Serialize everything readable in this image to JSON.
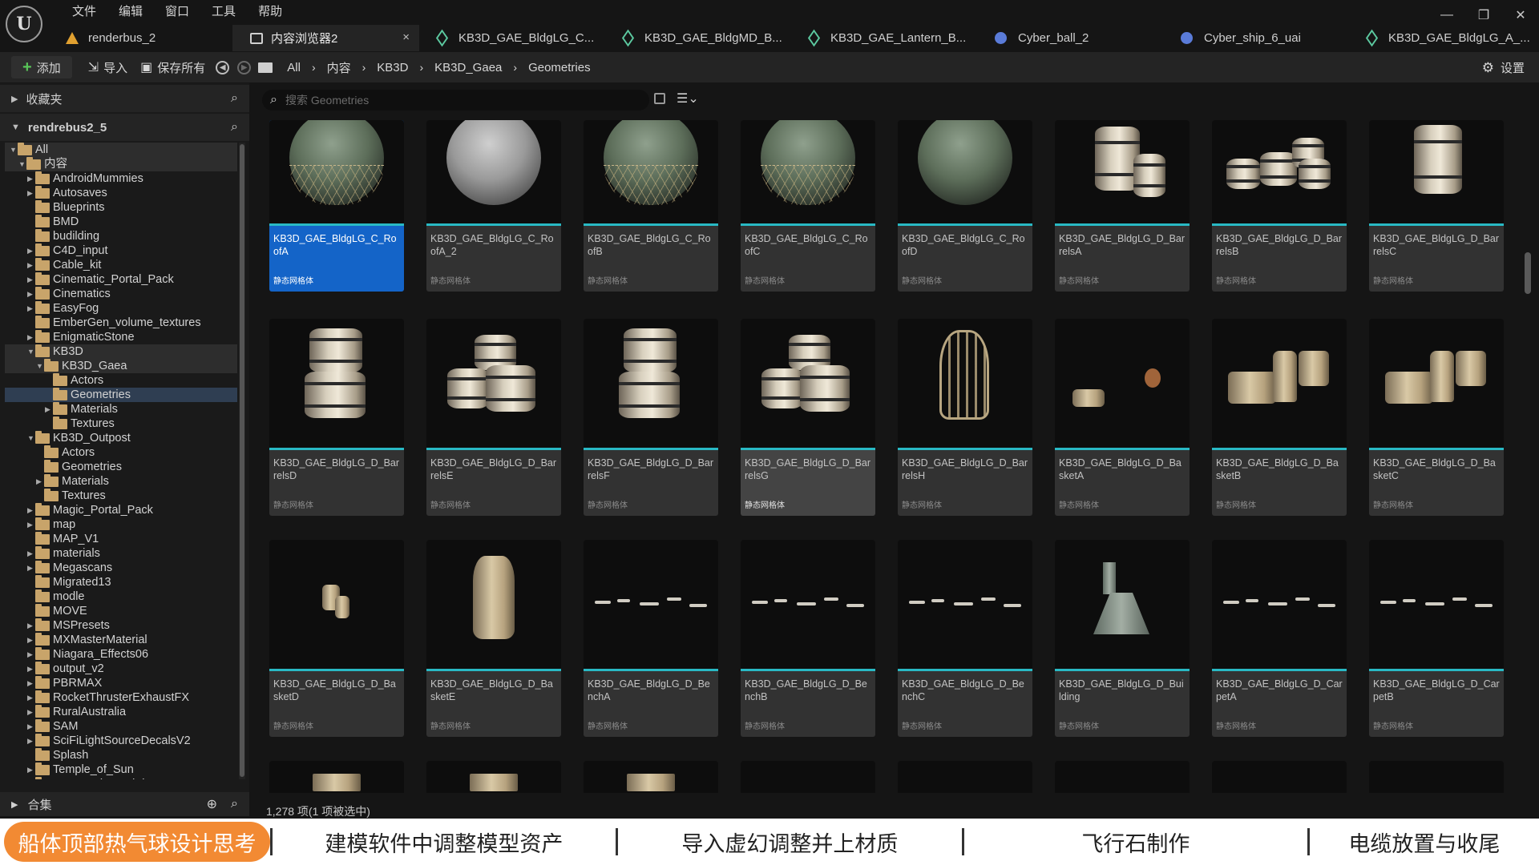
{
  "app": {
    "logo": "U",
    "menu": [
      "文件",
      "编辑",
      "窗口",
      "工具",
      "帮助"
    ],
    "window_controls": [
      "—",
      "❐",
      "✕"
    ]
  },
  "tabs": [
    {
      "label": "renderbus_2",
      "icon": "level-icon",
      "icon_color": "#e0a030",
      "active": false
    },
    {
      "label": "内容浏览器2",
      "icon": "content-browser-icon",
      "icon_color": "#d0d0d0",
      "active": true,
      "close": "×"
    },
    {
      "label": "KB3D_GAE_BldgLG_C...",
      "icon": "static-mesh-icon",
      "icon_color": "#5cc9a0",
      "active": false
    },
    {
      "label": "KB3D_GAE_BldgMD_B...",
      "icon": "static-mesh-icon",
      "icon_color": "#5cc9a0",
      "active": false
    },
    {
      "label": "KB3D_GAE_Lantern_B...",
      "icon": "static-mesh-icon",
      "icon_color": "#5cc9a0",
      "active": false
    },
    {
      "label": "Cyber_ball_2",
      "icon": "blueprint-icon",
      "icon_color": "#5a7bd8",
      "active": false
    },
    {
      "label": "Cyber_ship_6_uai",
      "icon": "blueprint-icon",
      "icon_color": "#5a7bd8",
      "active": false
    },
    {
      "label": "KB3D_GAE_BldgLG_A_...",
      "icon": "static-mesh-icon",
      "icon_color": "#5cc9a0",
      "active": false
    }
  ],
  "toolbar": {
    "add": "添加",
    "import": "导入",
    "save_all": "保存所有",
    "breadcrumb": [
      "All",
      "内容",
      "KB3D",
      "KB3D_Gaea",
      "Geometries"
    ],
    "settings": "设置"
  },
  "left": {
    "favorites": "收藏夹",
    "project": "rendrebus2_5",
    "collections": "合集",
    "tree": [
      {
        "label": "All",
        "depth": 0,
        "exp": "▼",
        "state": "hl"
      },
      {
        "label": "内容",
        "depth": 1,
        "exp": "▼",
        "state": "hl"
      },
      {
        "label": "AndroidMummies",
        "depth": 2,
        "exp": "▶"
      },
      {
        "label": "Autosaves",
        "depth": 2,
        "exp": "▶"
      },
      {
        "label": "Blueprints",
        "depth": 2,
        "exp": ""
      },
      {
        "label": "BMD",
        "depth": 2,
        "exp": ""
      },
      {
        "label": "budilding",
        "depth": 2,
        "exp": ""
      },
      {
        "label": "C4D_input",
        "depth": 2,
        "exp": "▶"
      },
      {
        "label": "Cable_kit",
        "depth": 2,
        "exp": "▶"
      },
      {
        "label": "Cinematic_Portal_Pack",
        "depth": 2,
        "exp": "▶"
      },
      {
        "label": "Cinematics",
        "depth": 2,
        "exp": "▶"
      },
      {
        "label": "EasyFog",
        "depth": 2,
        "exp": "▶"
      },
      {
        "label": "EmberGen_volume_textures",
        "depth": 2,
        "exp": ""
      },
      {
        "label": "EnigmaticStone",
        "depth": 2,
        "exp": "▶"
      },
      {
        "label": "KB3D",
        "depth": 2,
        "exp": "▼",
        "state": "hl"
      },
      {
        "label": "KB3D_Gaea",
        "depth": 3,
        "exp": "▼",
        "state": "hl"
      },
      {
        "label": "Actors",
        "depth": 4,
        "exp": ""
      },
      {
        "label": "Geometries",
        "depth": 4,
        "exp": "",
        "state": "sel"
      },
      {
        "label": "Materials",
        "depth": 4,
        "exp": "▶"
      },
      {
        "label": "Textures",
        "depth": 4,
        "exp": ""
      },
      {
        "label": "KB3D_Outpost",
        "depth": 2,
        "exp": "▼"
      },
      {
        "label": "Actors",
        "depth": 3,
        "exp": ""
      },
      {
        "label": "Geometries",
        "depth": 3,
        "exp": ""
      },
      {
        "label": "Materials",
        "depth": 3,
        "exp": "▶"
      },
      {
        "label": "Textures",
        "depth": 3,
        "exp": ""
      },
      {
        "label": "Magic_Portal_Pack",
        "depth": 2,
        "exp": "▶"
      },
      {
        "label": "map",
        "depth": 2,
        "exp": "▶"
      },
      {
        "label": "MAP_V1",
        "depth": 2,
        "exp": ""
      },
      {
        "label": "materials",
        "depth": 2,
        "exp": "▶"
      },
      {
        "label": "Megascans",
        "depth": 2,
        "exp": "▶"
      },
      {
        "label": "Migrated13",
        "depth": 2,
        "exp": ""
      },
      {
        "label": "modle",
        "depth": 2,
        "exp": ""
      },
      {
        "label": "MOVE",
        "depth": 2,
        "exp": ""
      },
      {
        "label": "MSPresets",
        "depth": 2,
        "exp": "▶"
      },
      {
        "label": "MXMasterMaterial",
        "depth": 2,
        "exp": "▶"
      },
      {
        "label": "Niagara_Effects06",
        "depth": 2,
        "exp": "▶"
      },
      {
        "label": "output_v2",
        "depth": 2,
        "exp": "▶"
      },
      {
        "label": "PBRMAX",
        "depth": 2,
        "exp": "▶"
      },
      {
        "label": "RocketThrusterExhaustFX",
        "depth": 2,
        "exp": "▶"
      },
      {
        "label": "RuralAustralia",
        "depth": 2,
        "exp": "▶"
      },
      {
        "label": "SAM",
        "depth": 2,
        "exp": "▶"
      },
      {
        "label": "SciFiLightSourceDecalsV2",
        "depth": 2,
        "exp": "▶"
      },
      {
        "label": "Splash",
        "depth": 2,
        "exp": ""
      },
      {
        "label": "Temple_of_Sun",
        "depth": 2,
        "exp": "▶"
      },
      {
        "label": "VertexAnimatedFlags",
        "depth": 2,
        "exp": "▶"
      }
    ]
  },
  "search": {
    "placeholder": "搜索 Geometries"
  },
  "asset_type_label": "静态网格体",
  "assets": [
    {
      "name": "KB3D_GAE_BldgLG_C_RoofA",
      "thumb": "sphere-net",
      "state": "selected"
    },
    {
      "name": "KB3D_GAE_BldgLG_C_RoofA_2",
      "thumb": "sphere-grey"
    },
    {
      "name": "KB3D_GAE_BldgLG_C_RoofB",
      "thumb": "sphere-net"
    },
    {
      "name": "KB3D_GAE_BldgLG_C_RoofC",
      "thumb": "sphere-net"
    },
    {
      "name": "KB3D_GAE_BldgLG_C_RoofD",
      "thumb": "sphere"
    },
    {
      "name": "KB3D_GAE_BldgLG_D_BarrelsA",
      "thumb": "barrels-a"
    },
    {
      "name": "KB3D_GAE_BldgLG_D_BarrelsB",
      "thumb": "barrels-b"
    },
    {
      "name": "KB3D_GAE_BldgLG_D_BarrelsC",
      "thumb": "barrel-single"
    },
    {
      "name": "KB3D_GAE_BldgLG_D_BarrelsD",
      "thumb": "barrels-stack2"
    },
    {
      "name": "KB3D_GAE_BldgLG_D_BarrelsE",
      "thumb": "barrels-stack3"
    },
    {
      "name": "KB3D_GAE_BldgLG_D_BarrelsF",
      "thumb": "barrels-stack2"
    },
    {
      "name": "KB3D_GAE_BldgLG_D_BarrelsG",
      "thumb": "barrels-stack3",
      "state": "hover"
    },
    {
      "name": "KB3D_GAE_BldgLG_D_BarrelsH",
      "thumb": "cage"
    },
    {
      "name": "KB3D_GAE_BldgLG_D_BasketA",
      "thumb": "basket-small"
    },
    {
      "name": "KB3D_GAE_BldgLG_D_BasketB",
      "thumb": "basket-group"
    },
    {
      "name": "KB3D_GAE_BldgLG_D_BasketC",
      "thumb": "basket-group"
    },
    {
      "name": "KB3D_GAE_BldgLG_D_BasketD",
      "thumb": "basket-tiny"
    },
    {
      "name": "KB3D_GAE_BldgLG_D_BasketE",
      "thumb": "basket-tall"
    },
    {
      "name": "KB3D_GAE_BldgLG_D_BenchA",
      "thumb": "bench"
    },
    {
      "name": "KB3D_GAE_BldgLG_D_BenchB",
      "thumb": "bench"
    },
    {
      "name": "KB3D_GAE_BldgLG_D_BenchC",
      "thumb": "bench"
    },
    {
      "name": "KB3D_GAE_BldgLG_D_Building",
      "thumb": "building"
    },
    {
      "name": "KB3D_GAE_BldgLG_D_CarpetA",
      "thumb": "bench"
    },
    {
      "name": "KB3D_GAE_BldgLG_D_CarpetB",
      "thumb": "bench"
    }
  ],
  "status": "1,278 项(1 项被选中)",
  "chapters": [
    {
      "label": "船体顶部热气球设计思考",
      "active": true
    },
    {
      "label": "建模软件中调整模型资产",
      "active": false
    },
    {
      "label": "导入虚幻调整并上材质",
      "active": false
    },
    {
      "label": "飞行石制作",
      "active": false
    },
    {
      "label": "电缆放置与收尾",
      "active": false
    }
  ]
}
